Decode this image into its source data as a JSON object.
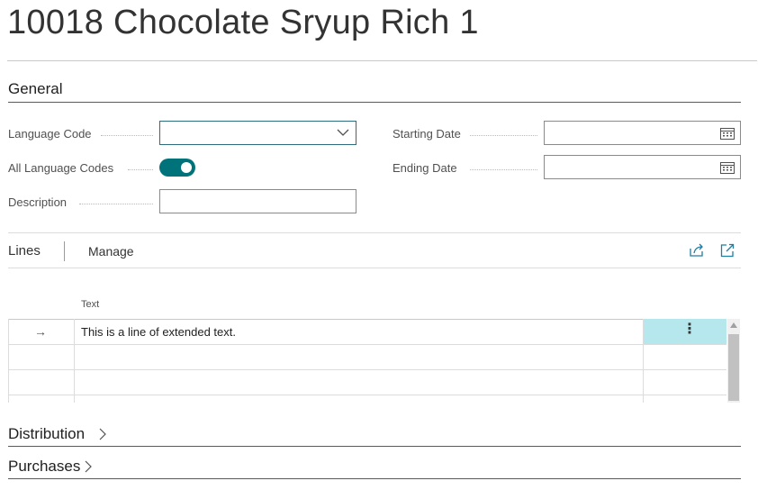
{
  "page": {
    "title": "10018 Chocolate Sryup Rich 1"
  },
  "general": {
    "heading": "General",
    "language_code_label": "Language Code",
    "language_code_value": "",
    "all_language_codes_label": "All Language Codes",
    "all_language_codes_on": true,
    "description_label": "Description",
    "description_value": "",
    "starting_date_label": "Starting Date",
    "starting_date_value": "",
    "ending_date_label": "Ending Date",
    "ending_date_value": ""
  },
  "lines": {
    "title": "Lines",
    "manage_label": "Manage",
    "column_text": "Text",
    "rows": [
      {
        "text": "This is a line of extended text.",
        "selected": true
      },
      {
        "text": ""
      },
      {
        "text": ""
      },
      {
        "text": ""
      }
    ]
  },
  "fasttabs": {
    "distribution": "Distribution",
    "purchases": "Purchases"
  },
  "icons": {
    "row_pointer": "→",
    "row_menu": "⋮"
  },
  "colors": {
    "toggle_on": "#00737a",
    "selected_cell": "#b5e7ec",
    "focus_border": "#2e6d80"
  }
}
